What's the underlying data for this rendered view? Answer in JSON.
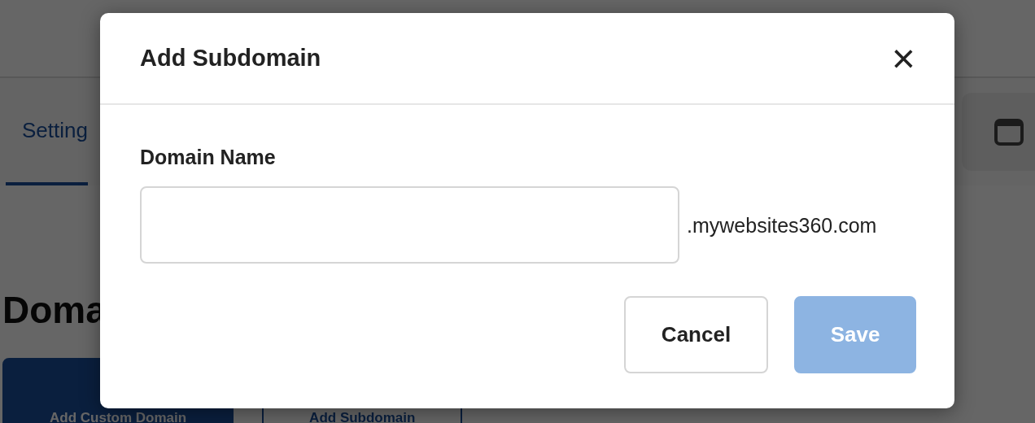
{
  "page": {
    "tabs": [
      {
        "label": "Setting",
        "selected": true
      }
    ],
    "heading": "Doma",
    "buttons": [
      {
        "label": "Add Custom Domain",
        "kind": "primary"
      },
      {
        "label": "Add Subdomain",
        "kind": "outline"
      }
    ]
  },
  "modal": {
    "title": "Add Subdomain",
    "close": "×",
    "field": {
      "label": "Domain Name",
      "suffix": ".mywebsites360.com"
    },
    "buttons": [
      {
        "label": "Cancel",
        "kind": "outline",
        "disabled": false
      },
      {
        "label": "Save",
        "kind": "primary",
        "disabled": true
      }
    ]
  }
}
